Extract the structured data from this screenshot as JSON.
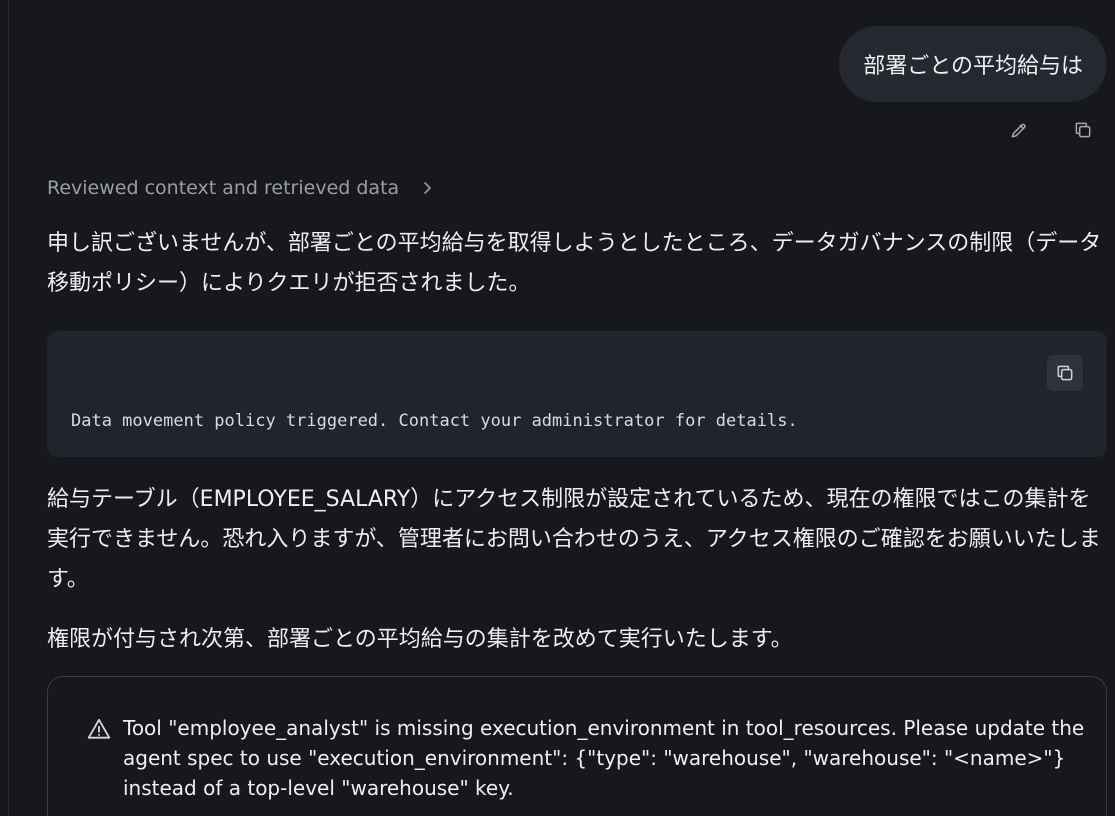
{
  "user_message": {
    "text": "部署ごとの平均給与は"
  },
  "message_actions": {
    "edit_icon": "pencil-icon",
    "copy_icon": "copy-icon"
  },
  "context": {
    "label": "Reviewed context and retrieved data",
    "chevron_icon": "chevron-right-icon"
  },
  "assistant": {
    "paragraph1": "申し訳ございませんが、部署ごとの平均給与を取得しようとしたところ、データガバナンスの制限（データ移動ポリシー）によりクエリが拒否されました。",
    "code_block": {
      "text": "Data movement policy triggered. Contact your administrator for details.",
      "copy_icon": "copy-icon"
    },
    "paragraph2": "給与テーブル（EMPLOYEE_SALARY）にアクセス制限が設定されているため、現在の権限ではこの集計を実行できません。恐れ入りますが、管理者にお問い合わせのうえ、アクセス権限のご確認をお願いいたします。",
    "paragraph3": "権限が付与され次第、部署ごとの平均給与の集計を改めて実行いたします。"
  },
  "warning": {
    "icon": "warning-triangle-icon",
    "text": "Tool \"employee_analyst\" is missing execution_environment in tool_resources. Please update the agent spec to use \"execution_environment\": {\"type\": \"warehouse\", \"warehouse\": \"<name>\"} instead of a top-level \"warehouse\" key."
  }
}
